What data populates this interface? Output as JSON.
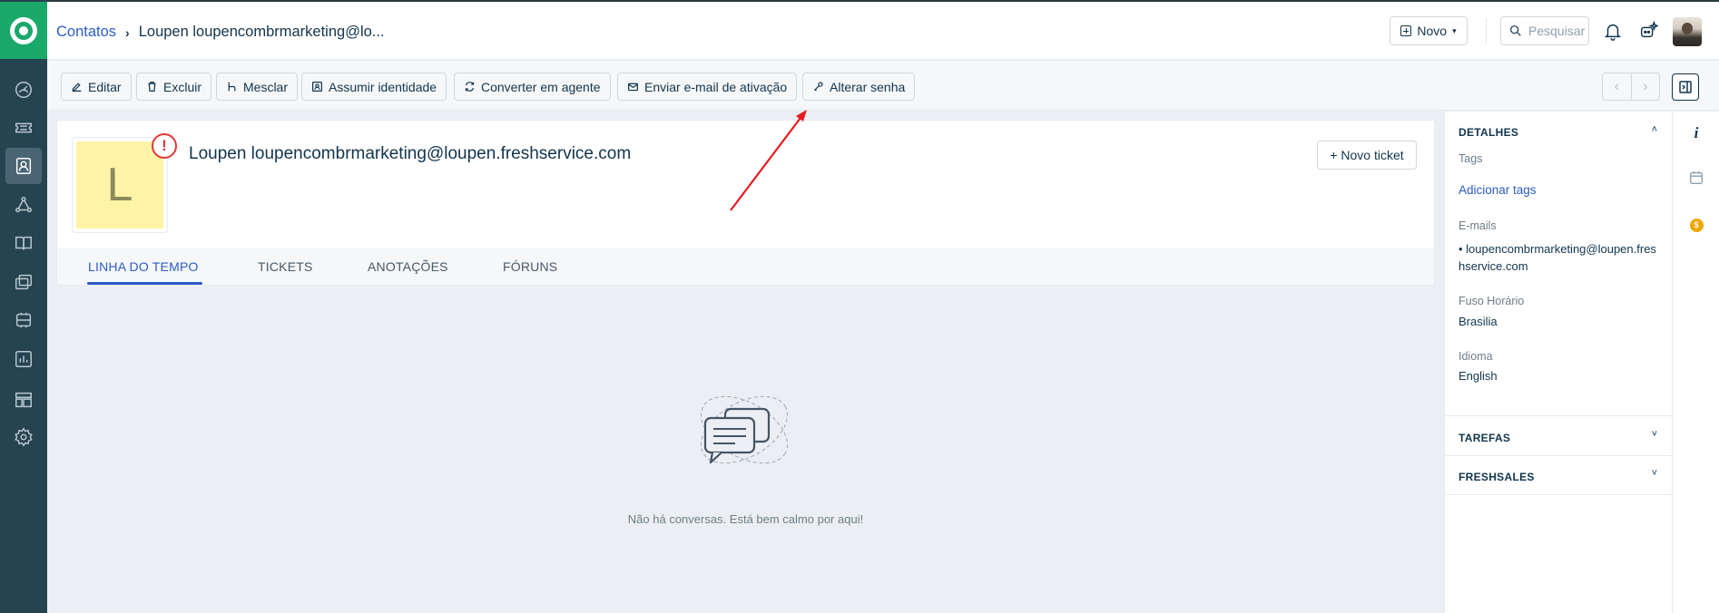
{
  "header": {
    "breadcrumb_parent": "Contatos",
    "breadcrumb_current": "Loupen loupencombrmarketing@lo...",
    "novo_label": "Novo",
    "search_placeholder": "Pesquisar"
  },
  "toolbar": {
    "buttons": [
      {
        "label": "Editar",
        "icon": "edit-icon"
      },
      {
        "label": "Excluir",
        "icon": "trash-icon"
      },
      {
        "label": "Mesclar",
        "icon": "merge-icon"
      },
      {
        "label": "Assumir identidade",
        "icon": "user-card-icon"
      },
      {
        "label": "Converter em agente",
        "icon": "refresh-icon"
      },
      {
        "label": "Enviar e-mail de ativação",
        "icon": "mail-icon"
      },
      {
        "label": "Alterar senha",
        "icon": "key-icon"
      }
    ],
    "pager_prev": "‹",
    "pager_next": "›"
  },
  "contact": {
    "initial": "L",
    "warning_badge": "!",
    "name": "Loupen loupencombrmarketing@loupen.freshservice.com",
    "novo_ticket_label": "+ Novo ticket"
  },
  "tabs": [
    {
      "label": "LINHA DO TEMPO",
      "active": true
    },
    {
      "label": "TICKETS",
      "active": false
    },
    {
      "label": "ANOTAÇÕES",
      "active": false
    },
    {
      "label": "FÓRUNS",
      "active": false
    }
  ],
  "empty_state": {
    "message": "Não há conversas. Está bem calmo por aqui!"
  },
  "details_panel": {
    "title": "DETALHES",
    "tags_label": "Tags",
    "add_tags_link": "Adicionar tags",
    "emails_label": "E-mails",
    "email_value": "loupencombrmarketing@loupen.freshservice.com",
    "timezone_label": "Fuso Horário",
    "timezone_value": "Brasilia",
    "language_label": "Idioma",
    "language_value": "English",
    "tasks_title": "TAREFAS",
    "freshsales_title": "FRESHSALES"
  },
  "right_strip": {
    "info_glyph": "i",
    "coin_glyph": "$"
  },
  "colors": {
    "brand_green": "#1aa86b",
    "nav_bg": "#264350",
    "link_blue": "#2c5cc5",
    "annotation_red": "#e8191f",
    "avatar_yellow": "#fff4a6"
  }
}
